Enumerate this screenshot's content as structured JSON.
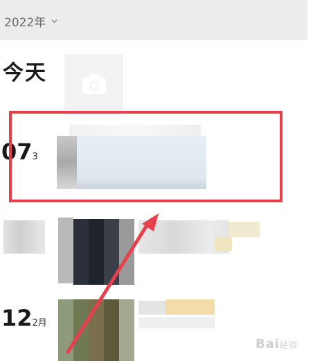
{
  "header": {
    "year_label": "2022年",
    "chevron_icon": "chevron-down-icon"
  },
  "sections": {
    "today_label": "今天",
    "camera_icon": "camera-icon",
    "entry1": {
      "day": "07",
      "month_suffix": "3"
    },
    "entry2": {
      "day": "12",
      "month_suffix": "2月"
    }
  },
  "annotation": {
    "highlight_color": "#e6404c",
    "arrow_color": "#e6404c"
  },
  "watermark": {
    "text": "Bai",
    "cn": "经验"
  }
}
